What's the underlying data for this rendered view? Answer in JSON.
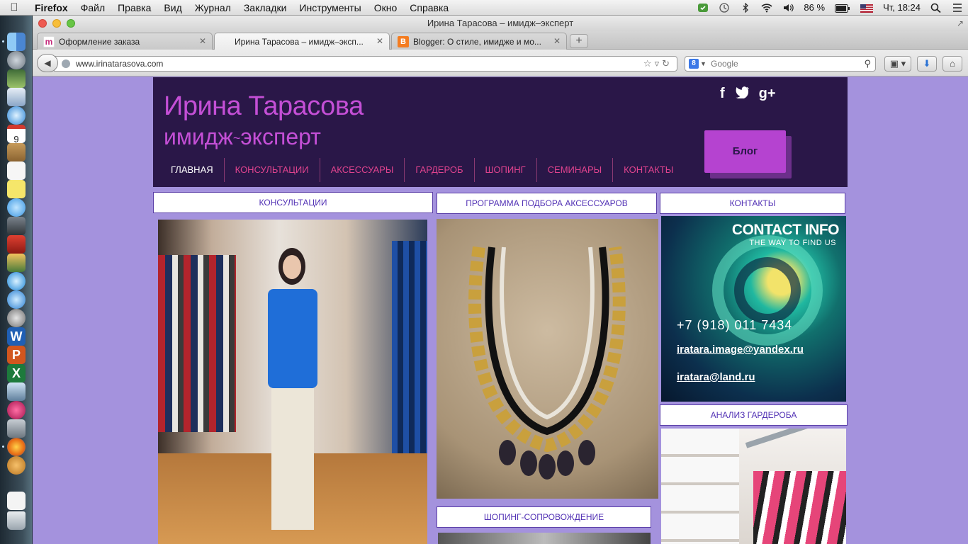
{
  "menubar": {
    "app": "Firefox",
    "items": [
      "Файл",
      "Правка",
      "Вид",
      "Журнал",
      "Закладки",
      "Инструменты",
      "Окно",
      "Справка"
    ],
    "battery": "86 %",
    "clock": "Чт, 18:24"
  },
  "window": {
    "title": "Ирина Тарасова – имидж–эксперт"
  },
  "tabs": [
    {
      "label": "Оформление заказа",
      "active": false
    },
    {
      "label": "Ирина Тарасова – имидж–эксп...",
      "active": true
    },
    {
      "label": "Blogger: О стиле, имидже и мо...",
      "active": false
    }
  ],
  "navbar": {
    "url": "www.irinatarasova.com",
    "search_placeholder": "Google"
  },
  "site": {
    "name": "Ирина Тарасова",
    "role": "имидж",
    "role_sep": "~",
    "role_rest": "эксперт",
    "blog_button": "Блог",
    "socials": [
      "f",
      "t",
      "g+"
    ],
    "nav": [
      {
        "label": "ГЛАВНАЯ",
        "active": true
      },
      {
        "label": "КОНСУЛЬТАЦИИ",
        "active": false
      },
      {
        "label": "АКСЕССУАРЫ",
        "active": false
      },
      {
        "label": "ГАРДЕРОБ",
        "active": false
      },
      {
        "label": "ШОПИНГ",
        "active": false
      },
      {
        "label": "СЕМИНАРЫ",
        "active": false
      },
      {
        "label": "КОНТАКТЫ",
        "active": false
      }
    ]
  },
  "blocks": {
    "consult_title": "КОНСУЛЬТАЦИИ",
    "accessories_title": "ПРОГРАММА ПОДБОРА АКСЕССУАРОВ",
    "contacts_title": "КОНТАКТЫ",
    "wardrobe_title": "АНАЛИЗ ГАРДЕРОБА",
    "shopping_title": "ШОПИНГ-СОПРОВОЖДЕНИЕ"
  },
  "contact_card": {
    "heading": "CONTACT INFO",
    "subheading": "THE WAY TO FIND US",
    "phone": "+7 (918) 011 7434",
    "email1": "iratara.image@yandex.ru",
    "email2": "iratara@land.ru"
  },
  "colors": {
    "page_bg": "#a492dd",
    "header_bg": "#2a1748",
    "brand_purple": "#c44fd6",
    "nav_pink": "#e0438e",
    "box_text": "#5333b5"
  }
}
